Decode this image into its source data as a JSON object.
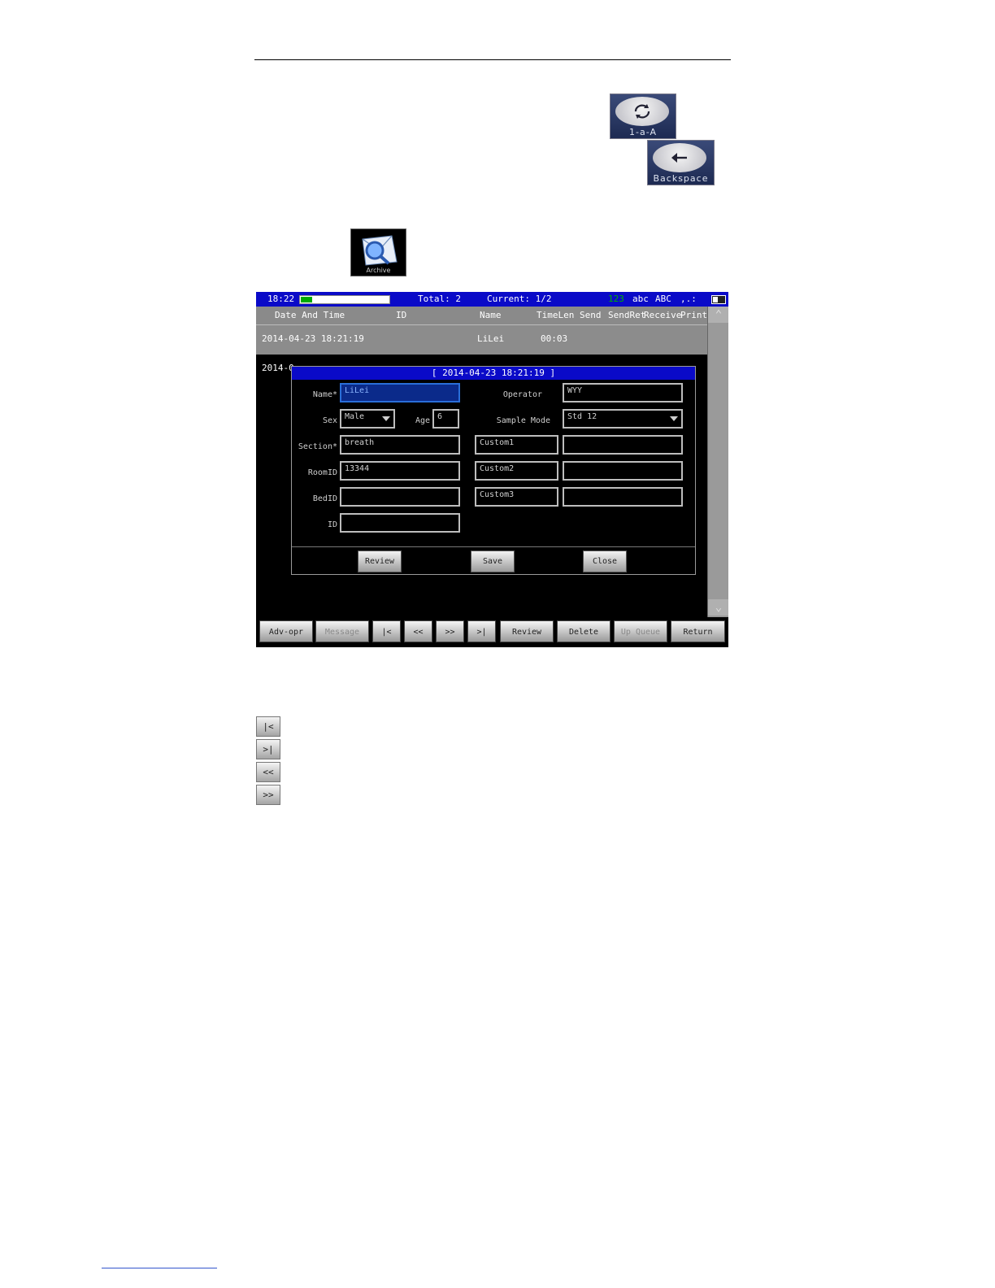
{
  "keys": {
    "cycle_key_label": "1-a-A",
    "backspace_key_label": "Backspace",
    "archive_icon_label": "Archive"
  },
  "status": {
    "time": "18:22",
    "progress": 0.13,
    "total": "Total: 2",
    "current": "Current: 1/2",
    "mode_123": "123",
    "mode_abc": "abc",
    "mode_ABC": "ABC",
    "mode_symbols": ",.:"
  },
  "columns": [
    "Date And Time",
    "ID",
    "Name",
    "TimeLen",
    "Send",
    "SendRet",
    "Receive",
    "Print"
  ],
  "rows": [
    {
      "datetime": "2014-04-23 18:21:19",
      "id": "",
      "name": "LiLei",
      "timelen": "00:03"
    },
    {
      "datetime": "2014-0",
      "id": "",
      "name": "",
      "timelen": ""
    }
  ],
  "dialog": {
    "title": "[ 2014-04-23 18:21:19 ]",
    "labels": {
      "name": "Name*",
      "sex": "Sex",
      "age": "Age",
      "section": "Section*",
      "roomid": "RoomID",
      "bedid": "BedID",
      "id": "ID",
      "operator": "Operator",
      "sample_mode": "Sample Mode"
    },
    "values": {
      "name": "LiLei",
      "sex": "Male",
      "age": "6",
      "section": "breath",
      "roomid": "13344",
      "bedid": "",
      "id": "",
      "operator": "WYY",
      "sample_mode": "Std 12",
      "custom1_label": "Custom1",
      "custom2_label": "Custom2",
      "custom3_label": "Custom3",
      "custom1_value": "",
      "custom2_value": "",
      "custom3_value": ""
    },
    "buttons": {
      "review": "Review",
      "save": "Save",
      "close": "Close"
    }
  },
  "toolbar": {
    "adv_opr": "Adv-opr",
    "message": "Message",
    "first": "|<",
    "prev": "<<",
    "next": ">>",
    "last": ">|",
    "review": "Review",
    "delete": "Delete",
    "up_queue": "Up Queue",
    "return": "Return"
  },
  "nav_icons": {
    "first": "|<",
    "last": ">|",
    "prev": "<<",
    "next": ">>"
  },
  "colors": {
    "titlebar": "#0a0ac8",
    "active_field": "#2a6ed8",
    "progress": "#00aa00",
    "mode_123": "#00b000"
  }
}
